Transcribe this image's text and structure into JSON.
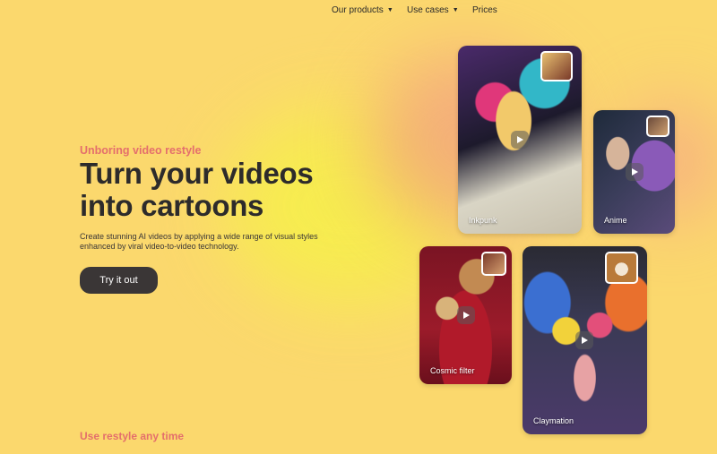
{
  "nav": {
    "items": [
      {
        "label": "Our products",
        "has_dropdown": true
      },
      {
        "label": "Use cases",
        "has_dropdown": true
      },
      {
        "label": "Prices",
        "has_dropdown": false
      }
    ]
  },
  "hero": {
    "eyebrow": "Unboring video restyle",
    "headline_line1": "Turn your videos",
    "headline_line2": "into cartoons",
    "description": "Create stunning AI videos by applying a wide range of visual styles enhanced by viral video-to-video technology.",
    "cta_label": "Try it out"
  },
  "style_cards": [
    {
      "label": "Inkpunk",
      "icon": "play-icon"
    },
    {
      "label": "Anime",
      "icon": "play-icon"
    },
    {
      "label": "Cosmic filter",
      "icon": "play-icon"
    },
    {
      "label": "Claymation",
      "icon": "play-icon"
    }
  ],
  "next_section": {
    "heading": "Use restyle any time"
  },
  "colors": {
    "background": "#fbd86d",
    "accent": "#e46f6c",
    "text_dark": "#2d2b2b",
    "button": "#3a3636"
  }
}
